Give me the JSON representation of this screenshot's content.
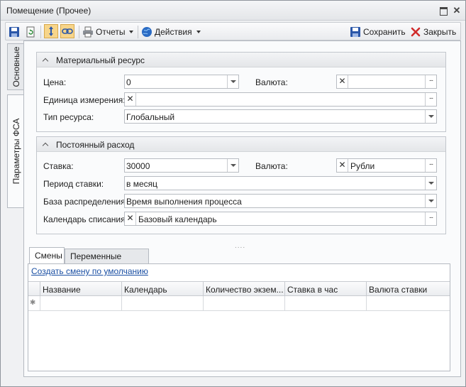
{
  "window": {
    "title": "Помещение (Прочее)"
  },
  "toolbar": {
    "reports_label": "Отчеты",
    "actions_label": "Действия",
    "save_label": "Сохранить",
    "close_label": "Закрыть"
  },
  "side_tabs": [
    {
      "label": "Основные"
    },
    {
      "label": "Параметры ФСА"
    }
  ],
  "material_group": {
    "title": "Материальный ресурс",
    "price_label": "Цена:",
    "price_value": "0",
    "currency_label": "Валюта:",
    "currency_value": "",
    "unit_label": "Единица измерения:",
    "unit_value": "",
    "resource_type_label": "Тип ресурса:",
    "resource_type_value": "Глобальный"
  },
  "fixed_group": {
    "title": "Постоянный расход",
    "rate_label": "Ставка:",
    "rate_value": "30000",
    "currency_label": "Валюта:",
    "currency_value": "Рубли",
    "period_label": "Период ставки:",
    "period_value": "в месяц",
    "base_label": "База распределения:",
    "base_value": "Время выполнения процесса",
    "calendar_label": "Календарь списания:",
    "calendar_value": "Базовый календарь"
  },
  "bottom_tabs": [
    {
      "label": "Смены"
    },
    {
      "label": "Переменные"
    }
  ],
  "shifts": {
    "create_link": "Создать смену по умолчанию",
    "columns": [
      "Название",
      "Календарь",
      "Количество экзем...",
      "Ставка в час",
      "Валюта ставки"
    ]
  },
  "colors": {
    "accent": "#1a4fa3",
    "border": "#b5bac1",
    "background": "#f0f1f3"
  }
}
